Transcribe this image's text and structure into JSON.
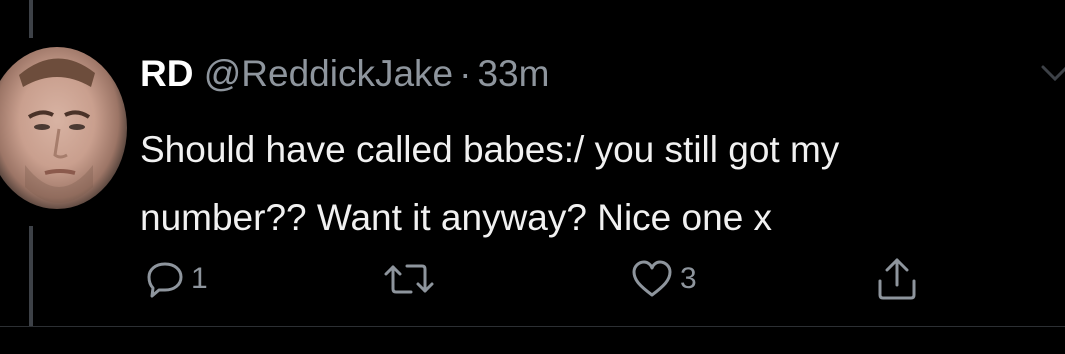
{
  "tweet": {
    "author_name": "RD",
    "handle": "@ReddickJake",
    "separator": "·",
    "time": "33m",
    "text_line1": "Should have called babes:/ you still got my",
    "text_line2": "number?? Want it anyway? Nice one x"
  },
  "actions": {
    "reply_count": "1",
    "retweet_count": "",
    "like_count": "3"
  },
  "icons": {
    "reply": "comment-bubble-icon",
    "retweet": "retweet-icon",
    "like": "heart-icon",
    "share": "share-icon",
    "menu": "chevron-down-icon"
  },
  "colors": {
    "background": "#000000",
    "primary_text": "#f1f1f1",
    "secondary_text": "#8e959d",
    "thread_line": "#3d4147"
  }
}
